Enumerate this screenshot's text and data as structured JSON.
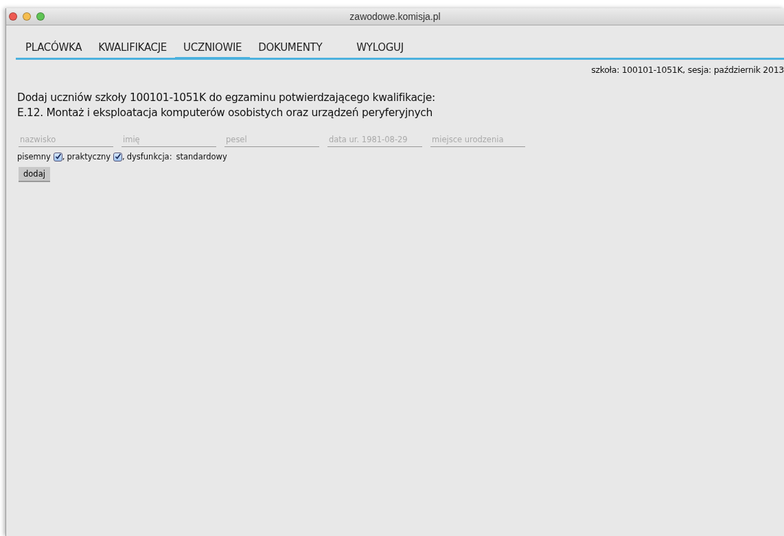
{
  "window": {
    "title": "zawodowe.komisja.pl"
  },
  "tabs": [
    {
      "label": "PLACÓWKA",
      "selected": false
    },
    {
      "label": "KWALIFIKACJE",
      "selected": false
    },
    {
      "label": "UCZNIOWIE",
      "selected": true
    },
    {
      "label": "DOKUMENTY",
      "selected": false
    },
    {
      "label": "WYLOGUJ",
      "selected": false
    }
  ],
  "session_info": "szkoła: 100101-1051K, sesja: październik 2013",
  "heading": [
    "Dodaj uczniów szkoły 100101-1051K do egzaminu potwierdzającego kwalifikacje:",
    "E.12. Montaż i eksploatacja komputerów osobistych oraz urządzeń peryferyjnych"
  ],
  "fields": [
    {
      "placeholder": "nazwisko"
    },
    {
      "placeholder": "imię"
    },
    {
      "placeholder": "pesel"
    },
    {
      "placeholder": "data ur. 1981-08-29"
    },
    {
      "placeholder": "miejsce urodzenia"
    }
  ],
  "options": [
    {
      "label": "pisemny",
      "checked": true,
      "suffix": ","
    },
    {
      "label": "praktyczny",
      "checked": true,
      "suffix": ","
    }
  ],
  "dysfunction": {
    "label": "dysfunkcja:",
    "value": "standardowy"
  },
  "add_button": "dodaj"
}
